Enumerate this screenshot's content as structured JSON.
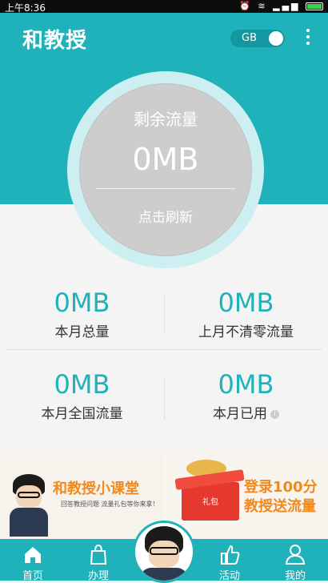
{
  "status_bar": {
    "time": "上午8:36",
    "icons": [
      "clock-icon",
      "wifi-icon",
      "signal-icon",
      "battery-icon"
    ]
  },
  "header": {
    "title": "和教授",
    "toggle_label": "GB",
    "toggle_on": true
  },
  "circle": {
    "title": "剩余流量",
    "value": "0MB",
    "refresh": "点击刷新"
  },
  "stats": [
    {
      "value": "0MB",
      "label": "本月总量"
    },
    {
      "value": "0MB",
      "label": "上月不清零流量"
    },
    {
      "value": "0MB",
      "label": "本月全国流量"
    },
    {
      "value": "0MB",
      "label": "本月已用"
    }
  ],
  "banners": {
    "left": {
      "title": "和教授小课堂",
      "subtitle": "回答教授问题  流量礼包等你来拿！"
    },
    "right": {
      "title_line1": "登录100分",
      "title_line2": "教授送流量",
      "gift_label": "礼包"
    }
  },
  "tabs": [
    {
      "label": "首页",
      "icon": "home-icon"
    },
    {
      "label": "办理",
      "icon": "bag-icon"
    },
    {
      "label": "活动",
      "icon": "thumbs-up-icon"
    },
    {
      "label": "我的",
      "icon": "user-icon"
    }
  ],
  "colors": {
    "accent": "#1fb2ba",
    "circle": "#cdcdcd",
    "banner_title": "#f08a1e"
  }
}
